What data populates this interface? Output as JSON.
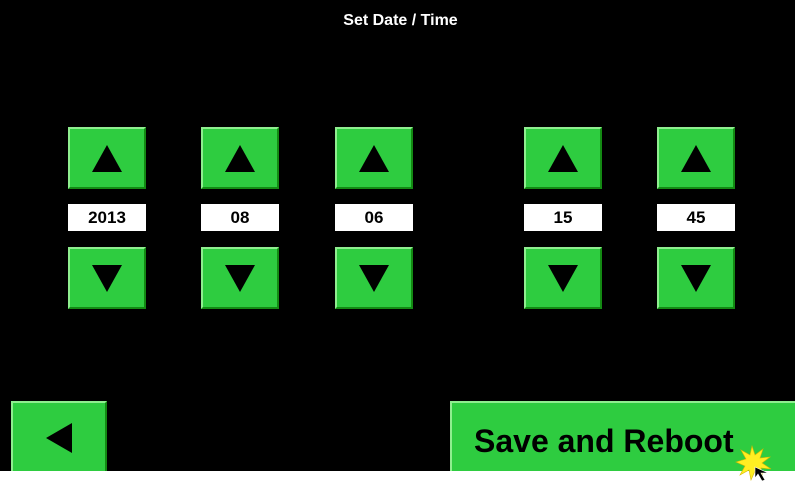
{
  "title": "Set Date / Time",
  "fields": [
    {
      "name": "year",
      "value": "2013"
    },
    {
      "name": "month",
      "value": "08"
    },
    {
      "name": "day",
      "value": "06"
    },
    {
      "name": "hour",
      "value": "15"
    },
    {
      "name": "minute",
      "value": "45"
    }
  ],
  "footer": {
    "save_label": "Save and Reboot"
  },
  "icons": {
    "increment": "triangle-up-icon",
    "decrement": "triangle-down-icon",
    "back": "triangle-left-icon",
    "cursor": "touch-cursor-icon"
  },
  "colors": {
    "background": "#000000",
    "button": "#2ecc40",
    "value_box": "#ffffff",
    "text": "#000000",
    "title_text": "#ffffff"
  }
}
